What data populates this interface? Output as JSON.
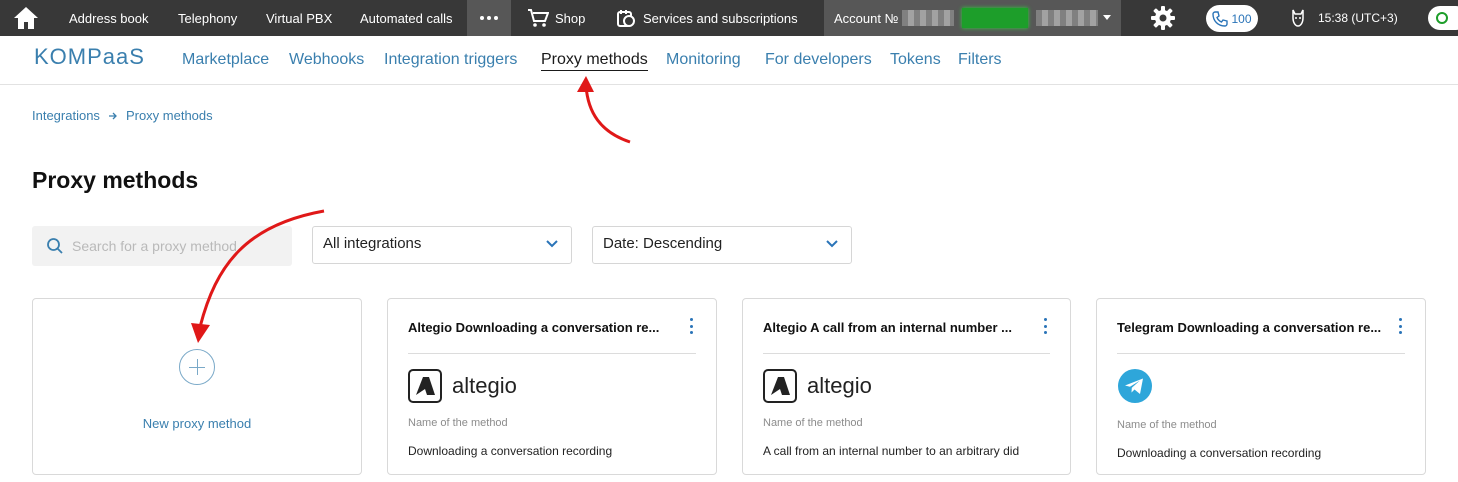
{
  "topbar": {
    "items": [
      "Address book",
      "Telephony",
      "Virtual PBX",
      "Automated calls"
    ],
    "shop": "Shop",
    "services": "Services and subscriptions",
    "account_label": "Account №",
    "phone_count": "100",
    "time": "15:38",
    "timezone": "(UTC+3)"
  },
  "brand": {
    "logo": "KOMPaaS"
  },
  "subnav": {
    "links": [
      "Marketplace",
      "Webhooks",
      "Integration triggers",
      "Proxy methods",
      "Monitoring",
      "For developers",
      "Tokens",
      "Filters"
    ],
    "active": "Proxy methods"
  },
  "breadcrumb": {
    "root": "Integrations",
    "current": "Proxy methods"
  },
  "page": {
    "title": "Proxy methods"
  },
  "filters": {
    "search_placeholder": "Search for a proxy method",
    "integration_select": "All integrations",
    "sort_select": "Date: Descending"
  },
  "new_card": {
    "label": "New proxy method"
  },
  "cards": [
    {
      "title": "Altegio Downloading a conversation re...",
      "brand": "altegio",
      "meta_label": "Name of the method",
      "meta_value": "Downloading a conversation recording"
    },
    {
      "title": "Altegio A call from an internal number ...",
      "brand": "altegio",
      "meta_label": "Name of the method",
      "meta_value": "A call from an internal number to an arbitrary did"
    },
    {
      "title": "Telegram Downloading a conversation re...",
      "brand": "",
      "meta_label": "Name of the method",
      "meta_value": "Downloading a conversation recording"
    }
  ],
  "colors": {
    "topbar_bg": "#383838",
    "accent": "#3a7fae",
    "arrow": "#e01818",
    "telegram": "#2ea6da",
    "account_green": "#1d9e2a"
  },
  "icons": {
    "home": "home-icon",
    "cart": "cart-icon",
    "services": "services-icon",
    "gear": "gear-icon",
    "phone": "phone-icon",
    "search": "search-icon",
    "chevron": "chevron-down-icon",
    "plus": "plus-icon",
    "kebab": "kebab-icon",
    "altegio": "altegio-logo-icon",
    "telegram": "telegram-icon"
  }
}
